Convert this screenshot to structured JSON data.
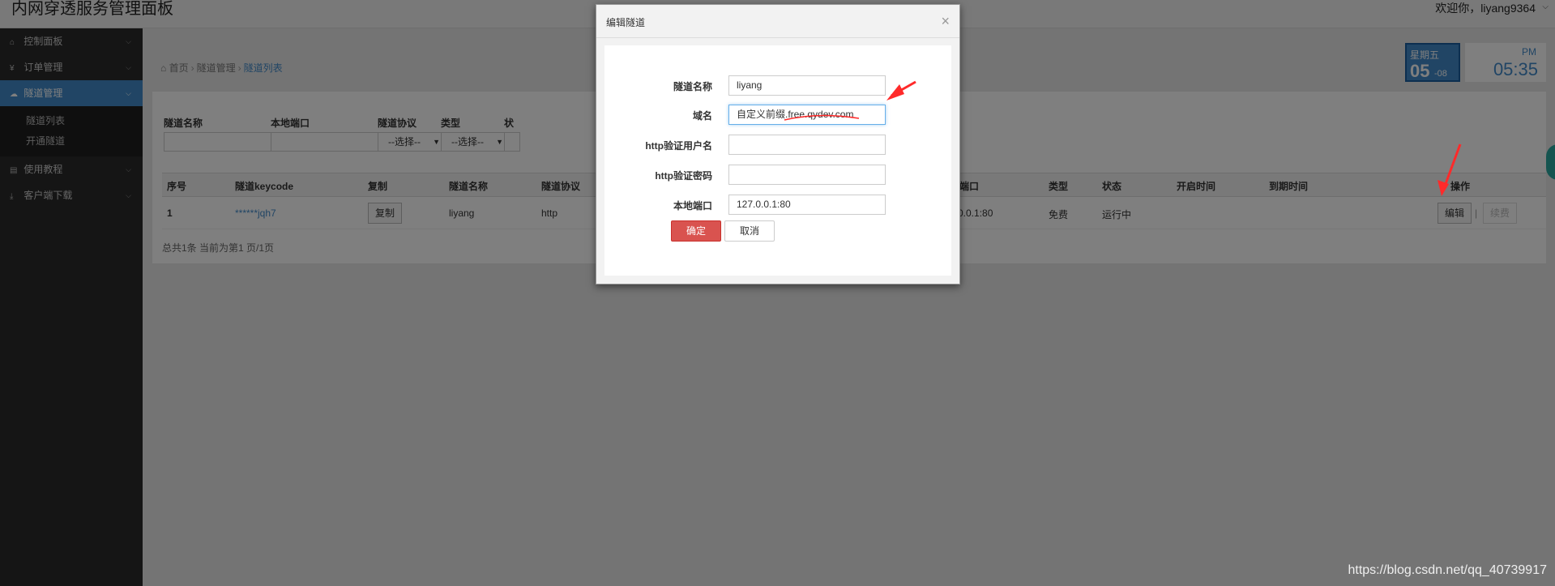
{
  "header": {
    "title": "内网穿透服务管理面板",
    "welcome": "欢迎你，liyang9364"
  },
  "sidebar": {
    "items": [
      {
        "label": "控制面板"
      },
      {
        "label": "订单管理"
      },
      {
        "label": "隧道管理"
      },
      {
        "label": "使用教程"
      },
      {
        "label": "客户端下载"
      }
    ],
    "submenu": [
      {
        "label": "隧道列表"
      },
      {
        "label": "开通隧道"
      }
    ]
  },
  "breadcrumb": {
    "home": "首页",
    "section": "隧道管理",
    "current": "隧道列表"
  },
  "clock": {
    "weekday": "星期五",
    "day": "05",
    "month": "-08",
    "ampm": "PM",
    "time": "05:35"
  },
  "filters": {
    "labels": [
      "隧道名称",
      "本地端口",
      "隧道协议",
      "类型",
      "状"
    ],
    "select_placeholder": "--选择--"
  },
  "table": {
    "headers": [
      "序号",
      "隧道keycode",
      "复制",
      "隧道名称",
      "隧道协议",
      "端口",
      "类型",
      "状态",
      "开启时间",
      "到期时间",
      "操作"
    ],
    "rows": [
      {
        "no": "1",
        "keycode": "******jqh7",
        "copy": "复制",
        "name": "liyang",
        "protocol": "http",
        "port": "0.0.1:80",
        "type": "免费",
        "status": "运行中",
        "edit": "编辑",
        "renew": "续费"
      }
    ],
    "pager": "总共1条 当前为第1 页/1页"
  },
  "modal": {
    "title": "编辑隧道",
    "fields": [
      {
        "label": "隧道名称",
        "value": "liyang"
      },
      {
        "label": "域名",
        "value": "自定义前缀.free.qydev.com"
      },
      {
        "label": "http验证用户名",
        "value": ""
      },
      {
        "label": "http验证密码",
        "value": ""
      },
      {
        "label": "本地端口",
        "value": "127.0.0.1:80"
      }
    ],
    "ok": "确定",
    "cancel": "取消"
  },
  "watermark": "https://blog.csdn.net/qq_40739917",
  "colors": {
    "accent": "#428bca",
    "danger": "#d9534f",
    "annotation": "#ff2a2a"
  }
}
